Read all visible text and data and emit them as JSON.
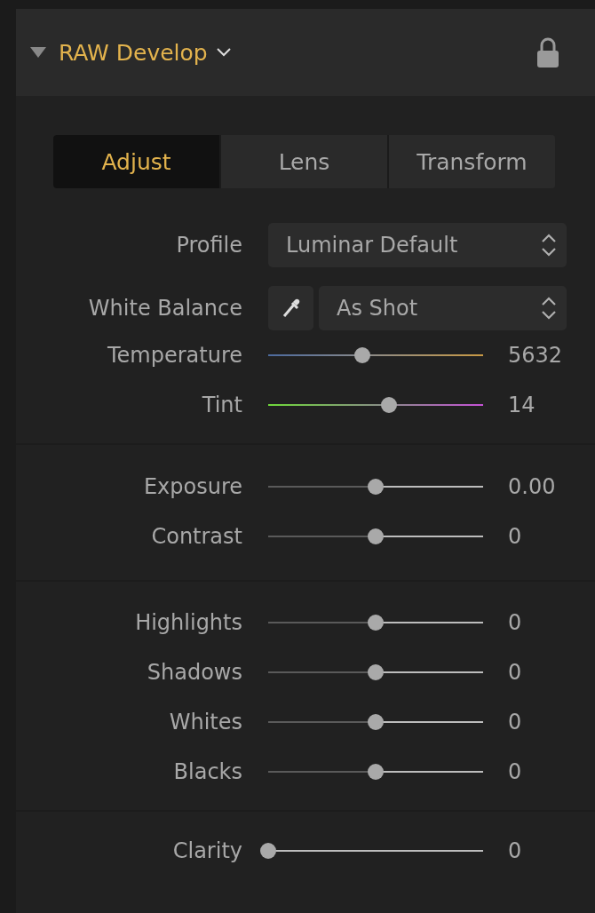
{
  "panel": {
    "title": "RAW Develop",
    "expanded": true,
    "locked": true
  },
  "tabs": [
    {
      "label": "Adjust",
      "selected": true
    },
    {
      "label": "Lens",
      "selected": false
    },
    {
      "label": "Transform",
      "selected": false
    }
  ],
  "profile": {
    "label": "Profile",
    "value": "Luminar Default"
  },
  "white_balance": {
    "label": "White Balance",
    "value": "As Shot"
  },
  "groups": [
    {
      "sliders": [
        {
          "label": "Temperature",
          "kind": "temperature",
          "level": 0.44,
          "reading": "5632"
        },
        {
          "label": "Tint",
          "kind": "tint",
          "level": 0.56,
          "reading": "14"
        }
      ]
    },
    {
      "sliders": [
        {
          "label": "Exposure",
          "kind": "plain",
          "level": 0.5,
          "reading": "0.00"
        },
        {
          "label": "Contrast",
          "kind": "plain",
          "level": 0.5,
          "reading": "0"
        }
      ]
    },
    {
      "sliders": [
        {
          "label": "Highlights",
          "kind": "plain",
          "level": 0.5,
          "reading": "0"
        },
        {
          "label": "Shadows",
          "kind": "plain",
          "level": 0.5,
          "reading": "0"
        },
        {
          "label": "Whites",
          "kind": "plain",
          "level": 0.5,
          "reading": "0"
        },
        {
          "label": "Blacks",
          "kind": "plain",
          "level": 0.5,
          "reading": "0"
        }
      ]
    },
    {
      "sliders": [
        {
          "label": "Clarity",
          "kind": "plain",
          "level": 0,
          "reading": "0"
        }
      ]
    }
  ]
}
